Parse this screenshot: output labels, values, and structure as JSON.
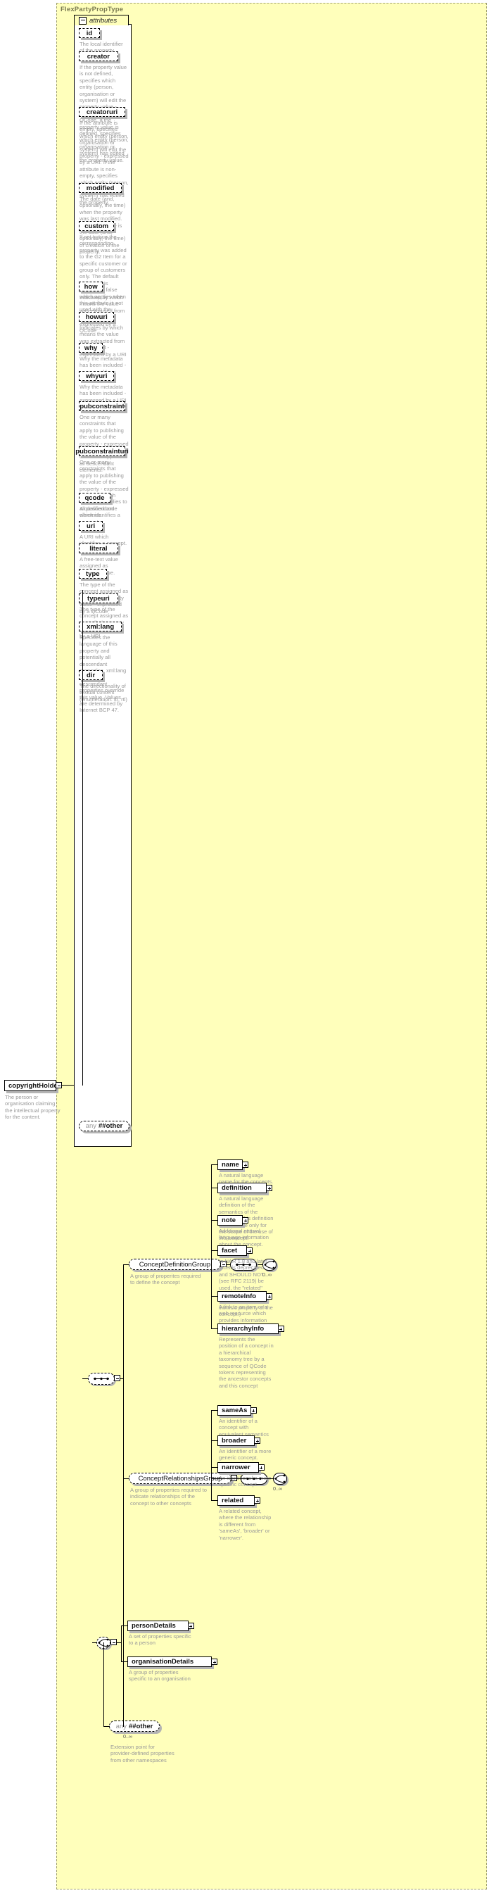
{
  "diagram": {
    "type": "xsd-schema-diagram",
    "complex_type": "FlexPartyPropType",
    "attributes_tab_label": "attributes"
  },
  "root_element": {
    "name": "copyrightHolder",
    "doc": "The person or organisation claiming the intellectual property for the content."
  },
  "attributes": [
    {
      "name": "id",
      "doc": "The local identifier of the property."
    },
    {
      "name": "creator",
      "doc": "If the property value is not defined, specifies which entity (person, organisation or system) will edit the property value - expressed by a QCode. If the property value is defined, specifies which entity (person, organisation or system) has edited the property value."
    },
    {
      "name": "creatoruri",
      "doc": "If the attribute is empty, specifies which entity (person, organisation or system) will edit the property - expressed by a URI. If the attribute is non-empty, specifies which entity (person, organisation or system) has edited the property."
    },
    {
      "name": "modified",
      "doc": "The date (and, optionally, the time) when the property was last modified. The initial value is the date (and, optionally, the time) of creation of the property."
    },
    {
      "name": "custom",
      "doc": "If set to true the corresponding property was added to the G2 Item for a specific customer or group of customers only. The default value of this property is false which applies when this attribute is not used with the property."
    },
    {
      "name": "how",
      "doc": "Indicates by which means the value was extracted from the content - expressed by a QCode"
    },
    {
      "name": "howuri",
      "doc": "Indicates by which means the value was extracted from the content - expressed by a URI"
    },
    {
      "name": "why",
      "doc": "Why the metadata has been included - expressed by a QCode"
    },
    {
      "name": "whyuri",
      "doc": "Why the metadata has been included - expressed by a URI"
    },
    {
      "name": "pubconstraint",
      "doc": "One or many constraints that apply to publishing the value of the property - expressed by a QCode. Each constraint applies to all descendant elements."
    },
    {
      "name": "pubconstrainturi",
      "doc": "One or many constraints that apply to publishing the value of the property - expressed by a URI. Each constraint applies to all descendant elements."
    },
    {
      "name": "qcode",
      "doc": "A qualified code which identifies a concept."
    },
    {
      "name": "uri",
      "doc": "A URI which identifies a concept."
    },
    {
      "name": "literal",
      "doc": "A free-text value assigned as property value."
    },
    {
      "name": "type",
      "doc": "The type of the concept assigned as controlled property value - expressed by a QCode"
    },
    {
      "name": "typeuri",
      "doc": "The type of the concept assigned as controlled property value - expressed by a URI"
    },
    {
      "name": "xml:lang",
      "doc": "Specifies the language of this property and potentially all descendant properties. xml:lang values of descendant properties override this value. Values are determined by Internet BCP 47."
    },
    {
      "name": "dir",
      "doc": "The directionality of textual content (enumeration: ltr, rtl)"
    }
  ],
  "attributes_any": {
    "label_any": "any",
    "label_ns": "##other"
  },
  "groups": [
    {
      "name": "ConceptDefinitionGroup",
      "doc": "A group of properites required to define the concept",
      "cardinality": "0..∞",
      "children": [
        {
          "name": "name",
          "doc": "A natural language name for the concepts."
        },
        {
          "name": "definition",
          "doc": "A natural language definition of the semantics of the concept. This definition is normative only for the scope of the use of this concept."
        },
        {
          "name": "note",
          "doc": "Additional natural language information about the concept."
        },
        {
          "name": "facet",
          "doc": "In NAR 1.8 and later, facet is deprecated and SHOULD NOT (see RFC 2119) be used, the \"related\" property should be used instead (was an intrinsic property of the concept.)"
        },
        {
          "name": "remoteInfo",
          "doc": "A link to an item or a web resource which provides information about the concept"
        },
        {
          "name": "hierarchyInfo",
          "doc": "Represents the position of a concept in a hierarchical taxonomy tree by a sequence of QCode tokens representing the ancestor concepts and this concept"
        }
      ]
    },
    {
      "name": "ConceptRelationshipsGroup",
      "doc": "A group of properties required to indicate relationships of the concept to other concepts",
      "cardinality": "0..∞",
      "children": [
        {
          "name": "sameAs",
          "doc": "An identifier of a concept with equivalent semantics"
        },
        {
          "name": "broader",
          "doc": "An identifier of a more generic concept."
        },
        {
          "name": "narrower",
          "doc": "An identifier of a more specific concept."
        },
        {
          "name": "related",
          "doc": "A related concept, where the relationship is different from 'sameAs', 'broader' or 'narrower'."
        }
      ]
    }
  ],
  "party_choice": [
    {
      "name": "personDetails",
      "doc": "A set of properties specific to a person"
    },
    {
      "name": "organisationDetails",
      "doc": "A group of properties specific to an organisation"
    }
  ],
  "tail_any": {
    "label_any": "any",
    "label_ns": "##other",
    "cardinality": "0..∞",
    "doc": "Extension point for provider-defined properties from other namespaces"
  },
  "colors": {
    "container_fill": "#ffffbb",
    "container_border": "#a0a070",
    "node_fill": "#ffffff",
    "node_border": "#000000",
    "doc_text": "#9a9a9a",
    "shadow": "#b4b4b4",
    "title_text": "#7a7a52"
  }
}
